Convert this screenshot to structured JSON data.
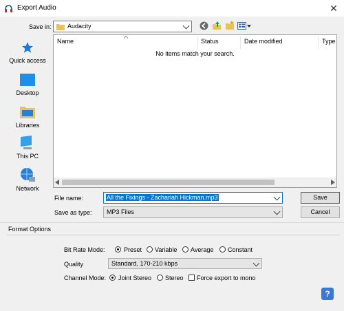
{
  "window": {
    "title": "Export Audio",
    "close_glyph": "✕"
  },
  "save_in": {
    "label": "Save in:",
    "value": "Audacity",
    "icon": "folder-icon"
  },
  "toolbar": {
    "back_icon": "back-icon",
    "up_icon": "up-folder-icon",
    "new_folder_icon": "new-folder-icon",
    "view_icon": "view-menu-icon"
  },
  "places": [
    {
      "label": "Quick access",
      "icon": "star-icon"
    },
    {
      "label": "Desktop",
      "icon": "desktop-icon"
    },
    {
      "label": "Libraries",
      "icon": "libraries-icon"
    },
    {
      "label": "This PC",
      "icon": "computer-icon"
    },
    {
      "label": "Network",
      "icon": "network-icon"
    }
  ],
  "file_list": {
    "columns": [
      "Name",
      "Status",
      "Date modified",
      "Type"
    ],
    "empty_message": "No items match your search."
  },
  "file_name": {
    "label": "File name:",
    "value": "All the Fixings - Zachariah Hickman.mp3"
  },
  "save_as_type": {
    "label": "Save as type:",
    "value": "MP3 Files"
  },
  "buttons": {
    "save": "Save",
    "cancel": "Cancel"
  },
  "format_options": {
    "title": "Format Options",
    "bit_rate_mode": {
      "label": "Bit Rate Mode:",
      "options": [
        "Preset",
        "Variable",
        "Average",
        "Constant"
      ],
      "selected": "Preset"
    },
    "quality": {
      "label": "Quality",
      "value": "Standard, 170-210 kbps"
    },
    "channel_mode": {
      "label": "Channel Mode:",
      "options": [
        "Joint Stereo",
        "Stereo"
      ],
      "selected": "Joint Stereo"
    },
    "force_mono": {
      "label": "Force export to mono",
      "checked": false
    }
  },
  "help": {
    "glyph": "?"
  },
  "colors": {
    "accent": "#0078d7",
    "selection": "#0078d7",
    "help": "#3b78d6"
  }
}
